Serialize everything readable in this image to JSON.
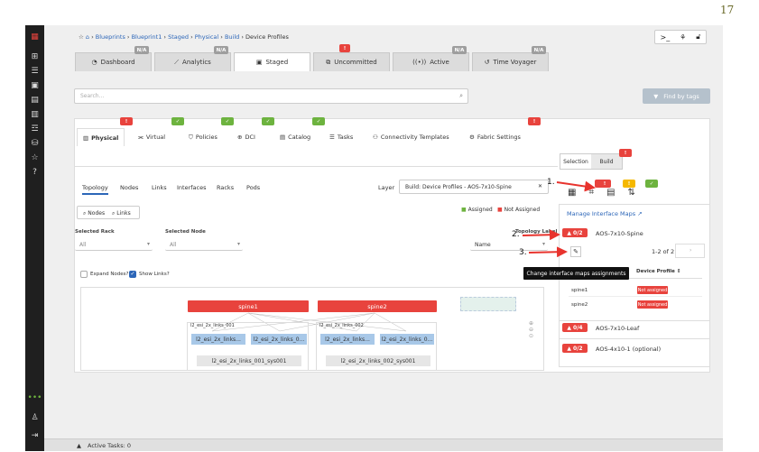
{
  "page_number": "17",
  "breadcrumb": {
    "items": [
      "Blueprints",
      "Blueprint1",
      "Staged",
      "Physical",
      "Build"
    ],
    "current": "Device Profiles"
  },
  "main_tabs": [
    {
      "label": "Dashboard",
      "badge": "N/A"
    },
    {
      "label": "Analytics",
      "badge": "N/A"
    },
    {
      "label": "Staged",
      "badge": ""
    },
    {
      "label": "Uncommitted",
      "badge": "!"
    },
    {
      "label": "Active",
      "badge": "N/A"
    },
    {
      "label": "Time Voyager",
      "badge": "N/A"
    }
  ],
  "search": {
    "placeholder": "Search..."
  },
  "find_by_tags": "Find by tags",
  "sub_tabs": [
    "Physical",
    "Virtual",
    "Policies",
    "DCI",
    "Catalog",
    "Tasks",
    "Connectivity Templates",
    "Fabric Settings"
  ],
  "topology_tabs": [
    "Topology",
    "Nodes",
    "Links",
    "Interfaces",
    "Racks",
    "Pods"
  ],
  "layer": {
    "label": "Layer",
    "value": "Build: Device Profiles - AOS-7x10-Spine"
  },
  "nodes_btn": "Nodes",
  "links_btn": "Links",
  "legend": {
    "assigned": "Assigned",
    "not_assigned": "Not Assigned"
  },
  "selected_rack": {
    "label": "Selected Rack",
    "value": "All"
  },
  "selected_node": {
    "label": "Selected Node",
    "value": "All"
  },
  "topology_label": {
    "label": "Topology Label",
    "value": "Name"
  },
  "expand_nodes": "Expand Nodes?",
  "show_links": "Show Links?",
  "topology": {
    "spines": [
      "spine1",
      "spine2"
    ],
    "groups": [
      {
        "name": "l2_esi_2x_links_001",
        "leaves": [
          "l2_esi_2x_links...",
          "l2_esi_2x_links_0..."
        ],
        "system": "l2_esi_2x_links_001_sys001"
      },
      {
        "name": "l2_esi_2x_links_002",
        "leaves": [
          "l2_esi_2x_links...",
          "l2_esi_2x_links_0..."
        ],
        "system": "l2_esi_2x_links_002_sys001"
      }
    ]
  },
  "right_panel": {
    "tab_selection": "Selection",
    "tab_build": "Build",
    "manage_interface_maps": "Manage Interface Maps",
    "pagination": "1-2 of 2",
    "spine_profile": {
      "count": "0/2",
      "name": "AOS-7x10-Spine"
    },
    "table_header_profile": "Device Profile",
    "rows": [
      {
        "name": "spine1",
        "status": "Not assigned"
      },
      {
        "name": "spine2",
        "status": "Not assigned"
      }
    ],
    "profiles": [
      {
        "count": "0/4",
        "name": "AOS-7x10-Leaf"
      },
      {
        "count": "0/2",
        "name": "AOS-4x10-1 (optional)"
      }
    ]
  },
  "tooltip": "Change interface maps assignments",
  "callouts": [
    "1.",
    "2.",
    "3."
  ],
  "footer": {
    "label": "Active Tasks: 0"
  }
}
